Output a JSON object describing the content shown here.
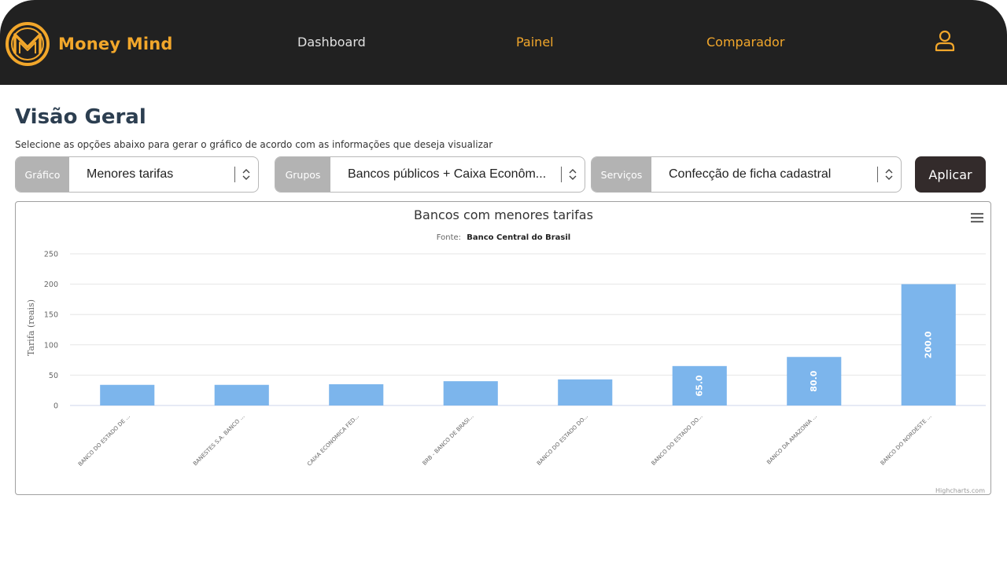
{
  "nav": {
    "brand": "Money Mind",
    "links": [
      "Dashboard",
      "Painel",
      "Comparador"
    ],
    "user_icon": "user-icon"
  },
  "page": {
    "title": "Visão Geral",
    "subtitle": "Selecione as opções abaixo para gerar o gráfico de acordo com as informações que deseja visualizar"
  },
  "filters": {
    "grafico": {
      "label": "Gráfico",
      "value": "Menores tarifas"
    },
    "grupos": {
      "label": "Grupos",
      "value": "Bancos públicos + Caixa Econôm..."
    },
    "servicos": {
      "label": "Serviços",
      "value": "Confecção de ficha cadastral"
    },
    "apply_label": "Aplicar"
  },
  "colors": {
    "accent": "#f2a72b",
    "bar": "#7cb5ec",
    "nav_bg": "#212121",
    "button": "#332b2b"
  },
  "chart_data": {
    "type": "bar",
    "title": "Bancos com menores tarifas",
    "subtitle_prefix": "Fonte:",
    "subtitle_source": "Banco Central do Brasil",
    "xlabel": "",
    "ylabel": "Tarifa (reais)",
    "ylim": [
      0,
      250
    ],
    "yticks": [
      0,
      50,
      100,
      150,
      200,
      250
    ],
    "grid": true,
    "categories": [
      "BANCO DO ESTADO DE ...",
      "BANESTES S.A. BANCO ...",
      "CAIXA ECONOMICA FED...",
      "BRB - BANCO DE BRASI...",
      "BANCO DO ESTADO DO...",
      "BANCO DO ESTADO DO...",
      "BANCO DA AMAZONIA ...",
      "BANCO DO NORDESTE ..."
    ],
    "values": [
      34,
      34,
      35,
      40,
      43,
      65,
      80,
      200
    ],
    "data_labels": [
      "",
      "",
      "",
      "",
      "",
      "65.0",
      "80.0",
      "200.0"
    ],
    "credits": "Highcharts.com"
  }
}
